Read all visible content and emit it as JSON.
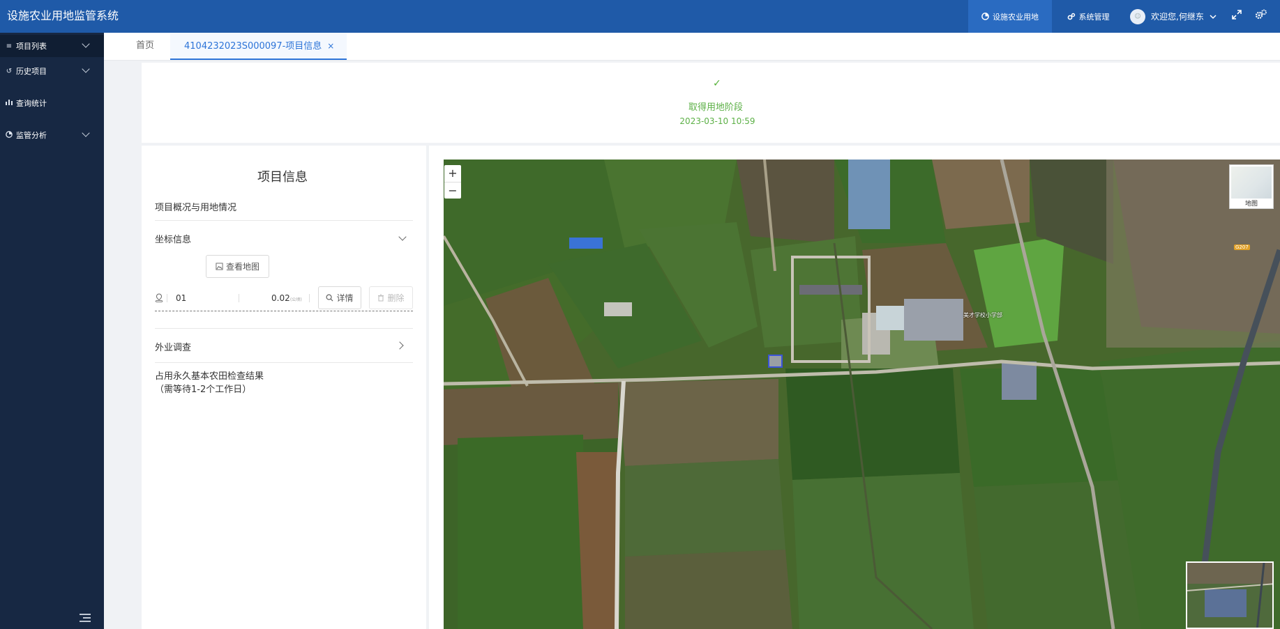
{
  "header": {
    "title": "设施农业用地监管系统",
    "nav": [
      {
        "label": "设施农业用地",
        "icon": "pie-chart-icon"
      },
      {
        "label": "系统管理",
        "icon": "settings-icon"
      }
    ],
    "user": {
      "greeting": "欢迎您,何继东",
      "avatar_text": "☺"
    }
  },
  "sidebar": {
    "items": [
      {
        "label": "项目列表",
        "icon": "list-icon"
      },
      {
        "label": "历史项目",
        "icon": "history-icon"
      },
      {
        "label": "查询统计",
        "icon": "bar-chart-icon"
      },
      {
        "label": "监管分析",
        "icon": "pie-chart-icon"
      }
    ]
  },
  "tabs": [
    {
      "label": "首页"
    },
    {
      "label": "4104232023S000097-项目信息",
      "close": "×"
    }
  ],
  "stage": {
    "check": "✓",
    "title": "取得用地阶段",
    "date": "2023-03-10 10:59"
  },
  "info": {
    "title": "项目信息",
    "overview": "项目概况与用地情况",
    "coords_label": "坐标信息",
    "view_map_label": "查看地图",
    "coord_row": {
      "id": "01",
      "area": "0.02",
      "unit": "(公顷)",
      "detail_label": "详情",
      "delete_label": "删除"
    },
    "survey_label": "外业调查",
    "farmland_line1": "占用永久基本农田检查结果",
    "farmland_line2": "（需等待1-2个工作日）"
  },
  "map": {
    "zoom_in": "+",
    "zoom_out": "−",
    "maptype_label": "地图",
    "school_label": "美才学校小学部",
    "road_badge": "G207"
  },
  "colors": {
    "header": "#1f5aa8",
    "sidebar": "#172843",
    "accent": "#2d74d8",
    "success": "#5cb046"
  }
}
